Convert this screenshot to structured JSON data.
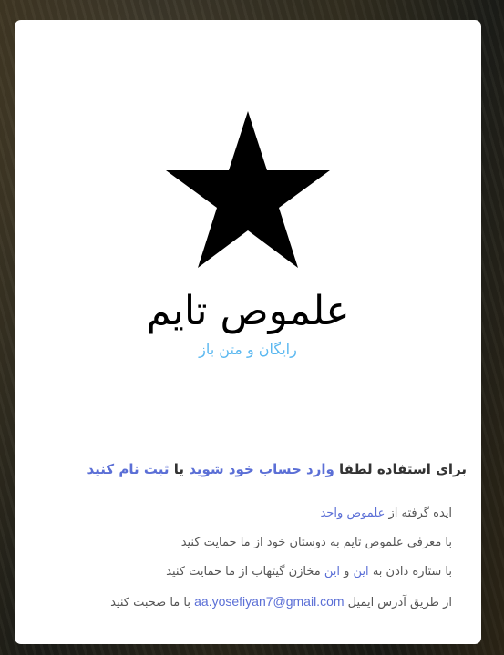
{
  "app": {
    "title": "علموص تایم",
    "tagline": "رایگان و متن باز"
  },
  "login": {
    "prompt_prefix": "برای استفاده لطفا ",
    "login_link": "وارد حساب خود شوید",
    "separator": " یا ",
    "register_link": "ثبت نام کنید"
  },
  "info": {
    "idea_prefix": "ایده گرفته از ",
    "idea_link": "علموص واحد",
    "share_text": "با معرفی علموص تایم به دوستان خود از ما حمایت کنید",
    "star_prefix": "با ستاره دادن به ",
    "star_link_1": "این",
    "star_and": " و ",
    "star_link_2": "این",
    "star_suffix": " مخازن گیتهاب از ما حمایت کنید",
    "contact_prefix": "از طریق آدرس ایمیل ",
    "email": "aa.yosefiyan7@gmail.com",
    "contact_suffix": " با ما صحبت کنید"
  },
  "colors": {
    "link": "#5b6fd6",
    "tagline": "#5bb8f0",
    "card": "#ffffff"
  },
  "icons": {
    "logo": "star-icon"
  }
}
